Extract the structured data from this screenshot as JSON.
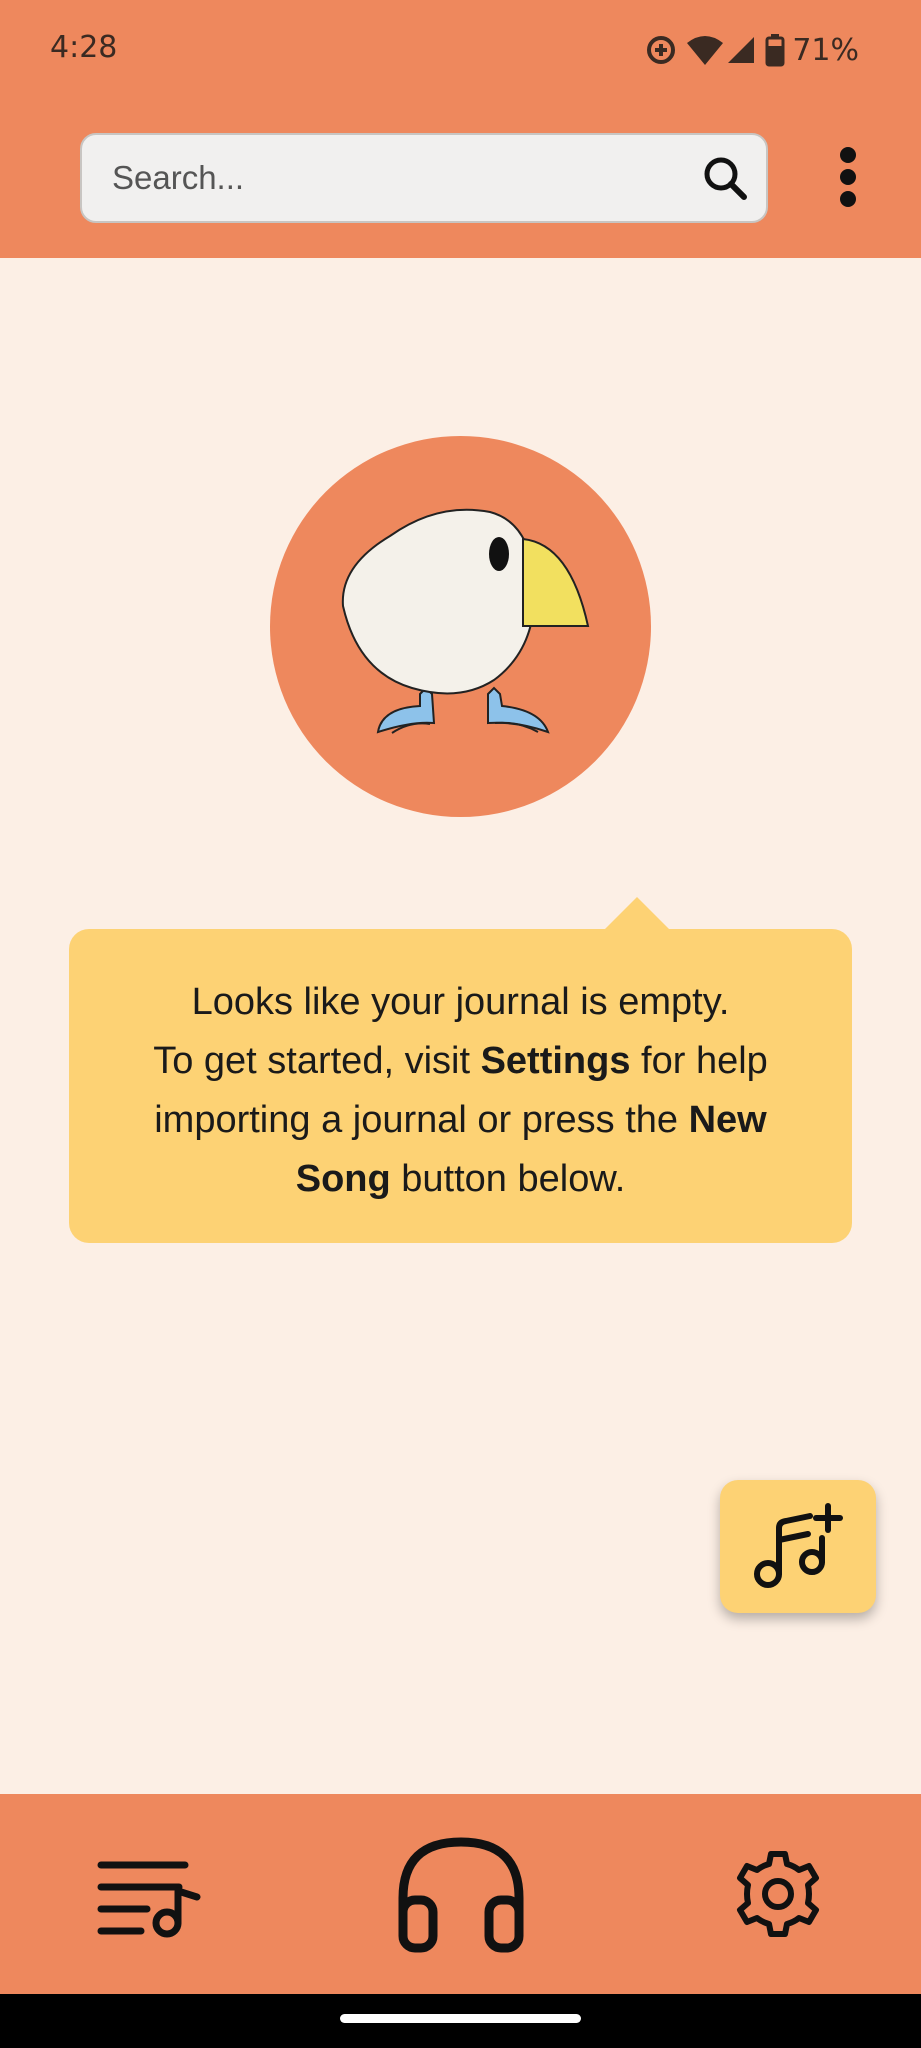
{
  "status_bar": {
    "time": "4:28",
    "battery": "71%"
  },
  "search": {
    "placeholder": "Search...",
    "value": ""
  },
  "empty_state": {
    "line1": "Looks like your journal is empty.",
    "line2_prefix": "To get started, visit ",
    "settings_word": "Settings",
    "line2_suffix": " for help importing a journal or press the ",
    "new_song_words": "New Song",
    "line_end": " button below."
  },
  "colors": {
    "accent": "#ee885d",
    "background": "#fcefe5",
    "bubble": "#fdd274"
  },
  "icons": {
    "search": "search-icon",
    "more": "more-vert-icon",
    "fab": "music-note-plus-icon",
    "nav_journal": "playlist-music-icon",
    "nav_listen": "headphones-icon",
    "nav_settings": "gear-icon"
  }
}
